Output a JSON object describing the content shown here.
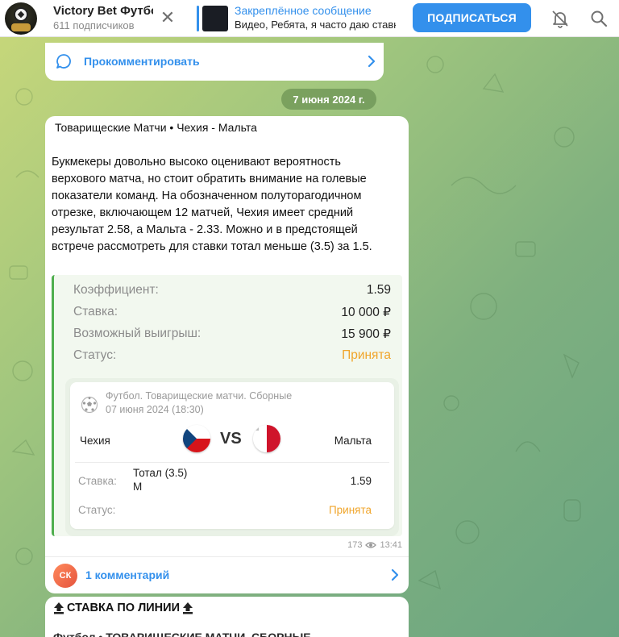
{
  "header": {
    "channel_title": "Victory Bet Футбол",
    "subscribers": "611 подписчиков",
    "pinned_title": "Закреплённое сообщение",
    "pinned_text": "Видео, Ребята, я часто даю ставки",
    "subscribe_label": "ПОДПИСАТЬСЯ"
  },
  "top_comment": {
    "label": "Прокомментировать"
  },
  "date_separator": "7 июня 2024 г.",
  "post": {
    "title": "Товарищеские Матчи • Чехия - Мальта",
    "body": "Букмекеры довольно высоко оценивают вероятность верхового матча, но стоит обратить внимание на голевые показатели команд. На обозначенном полуторагодичном отрезке, включающем 12 матчей, Чехия имеет средний результат 2.58, а Мальта - 2.33. Можно и в предстоящей встрече рассмотреть для ставки тотал меньше (3.5) за 1.5.",
    "bet": {
      "rows": [
        {
          "key": "Коэффициент:",
          "value": "1.59"
        },
        {
          "key": "Ставка:",
          "value": "10 000 ₽"
        },
        {
          "key": "Возможный выигрыш:",
          "value": "15 900 ₽"
        },
        {
          "key": "Статус:",
          "value": "Принята"
        }
      ]
    },
    "match": {
      "league": "Футбол. Товарищеские матчи. Сборные",
      "datetime": "07 июня 2024 (18:30)",
      "team_left": "Чехия",
      "team_right": "Мальта",
      "vs": "VS",
      "bet_label": "Ставка:",
      "bet_name": "Тотал (3.5) М",
      "bet_odds": "1.59",
      "status_label": "Статус:",
      "status_value": "Принята"
    },
    "views": "173",
    "time": "13:41",
    "comments_label": "1 комментарий",
    "commenter_initials": "СК"
  },
  "next_post": {
    "title": "СТАВКА ПО ЛИНИИ",
    "subtitle": "Футбол • ТОВАРИЩЕСКИЕ МАТЧИ. СБОРНЫЕ"
  },
  "colors": {
    "accent": "#3390ec",
    "status": "#f0a52b",
    "bet_border": "#4fae4e"
  }
}
